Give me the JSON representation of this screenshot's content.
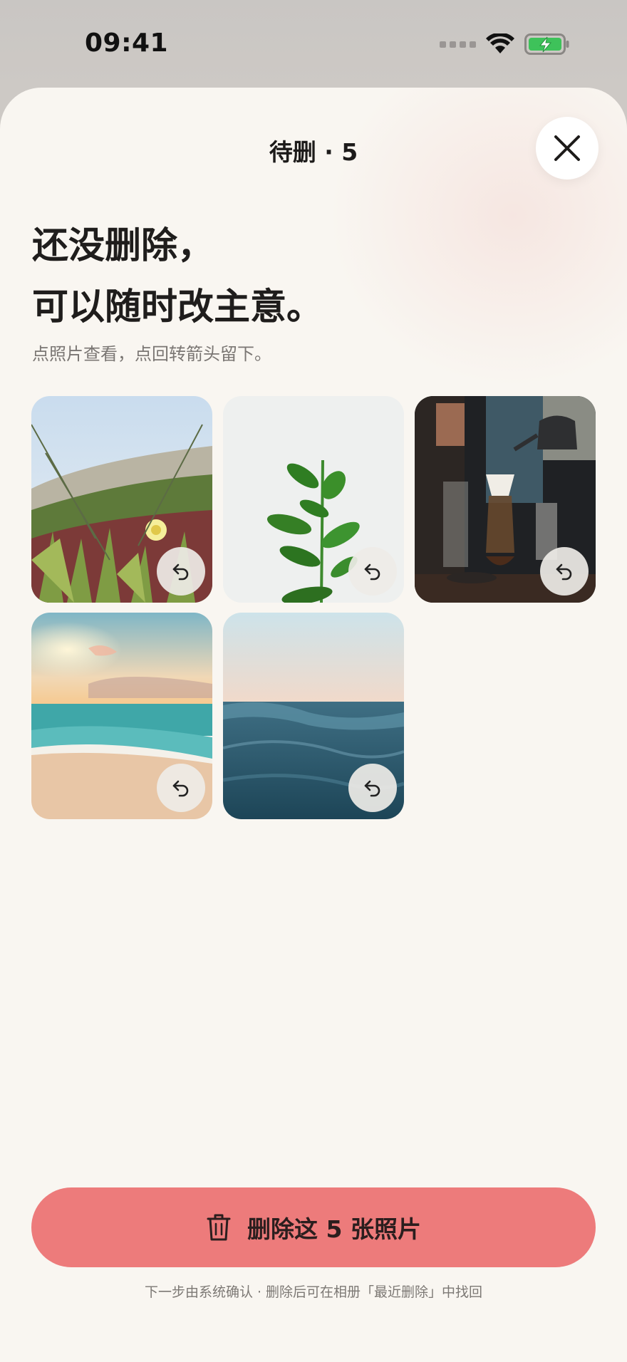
{
  "status_bar": {
    "time": "09:41",
    "icons": [
      "signal-icon",
      "wifi-icon",
      "battery-charging-icon"
    ],
    "battery_color": "#3ec25a"
  },
  "header": {
    "title": "待删 · 5",
    "close_icon": "close-icon"
  },
  "intro": {
    "headline_line1": "还没删除，",
    "headline_line2": "可以随时改主意。",
    "hint": "点照片查看，点回转箭头留下。"
  },
  "photos": [
    {
      "subject": "beach-grass-flower",
      "restore_icon": "undo-icon"
    },
    {
      "subject": "green-plant",
      "restore_icon": "undo-icon"
    },
    {
      "subject": "coffee-bar",
      "restore_icon": "undo-icon"
    },
    {
      "subject": "sunset-beach",
      "restore_icon": "undo-icon"
    },
    {
      "subject": "ocean-wave",
      "restore_icon": "undo-icon"
    }
  ],
  "footer": {
    "delete_label": "删除这 5 张照片",
    "delete_icon": "trash-icon",
    "delete_color": "#ed7b7b",
    "note": "下一步由系统确认 · 删除后可在相册「最近删除」中找回"
  }
}
